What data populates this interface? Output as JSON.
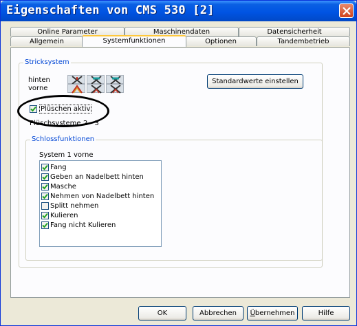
{
  "window": {
    "title": "Eigenschaften von CMS 530 [2]"
  },
  "tabs": {
    "row_back": [
      "Online Parameter",
      "Maschinendaten",
      "Datensicherheit"
    ],
    "row_front": [
      "Allgemein",
      "Systemfunktionen",
      "Optionen",
      "Tandembetrieb"
    ],
    "active": "Systemfunktionen"
  },
  "stricksystem": {
    "group_title": "Stricksystem",
    "hinten_label": "hinten",
    "vorne_label": "vorne",
    "standard_button": "Standardwerte einstellen",
    "pluschen_label": "Plüschen aktiv",
    "pluschen_checked": true,
    "pluschsysteme_label": "Plüschsysteme",
    "pluschsysteme_value": "2  -  3"
  },
  "schlossfunktionen": {
    "group_title": "Schlossfunktionen",
    "system_label": "System 1 vorne",
    "items": [
      {
        "label": "Fang",
        "checked": true
      },
      {
        "label": "Geben an Nadelbett hinten",
        "checked": true
      },
      {
        "label": "Masche",
        "checked": true
      },
      {
        "label": "Nehmen von Nadelbett hinten",
        "checked": true
      },
      {
        "label": "Splitt nehmen",
        "checked": false
      },
      {
        "label": "Kulieren",
        "checked": true
      },
      {
        "label": "Fang nicht Kulieren",
        "checked": true
      }
    ]
  },
  "buttons": {
    "ok": "OK",
    "abbrechen": "Abbrechen",
    "uebernehmen": "Übernehmen",
    "hilfe": "Hilfe"
  },
  "colors": {
    "titlebar": "#0054e3",
    "group_title": "#0046d5",
    "check": "#21a121",
    "annotation": "#000000"
  }
}
